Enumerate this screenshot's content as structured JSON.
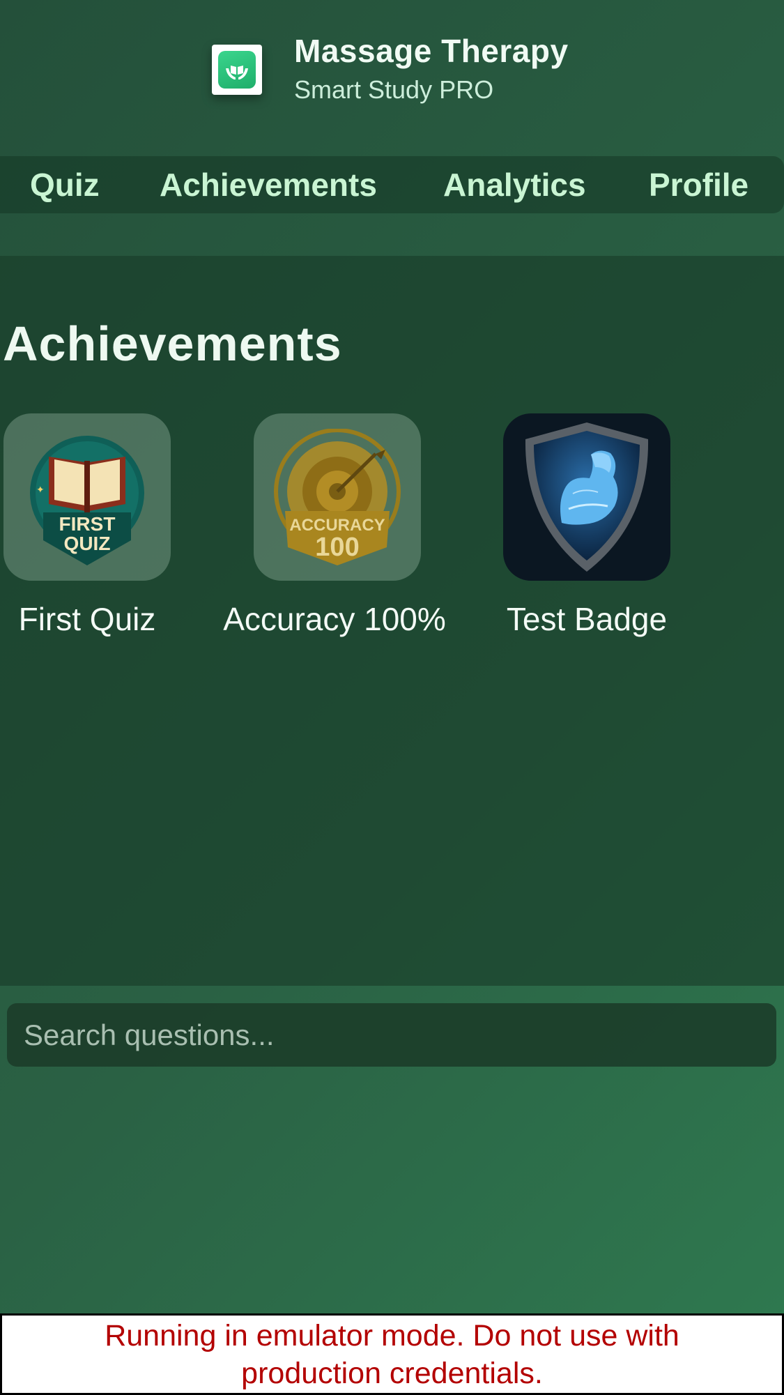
{
  "header": {
    "title": "Massage Therapy",
    "subtitle": "Smart Study PRO",
    "logo_icon": "hands-holding-book-icon"
  },
  "tabs": [
    {
      "label": "Quiz"
    },
    {
      "label": "Achievements"
    },
    {
      "label": "Analytics"
    },
    {
      "label": "Profile"
    }
  ],
  "achievements": {
    "title": "Achievements",
    "badges": [
      {
        "label": "First Quiz",
        "icon": "first-quiz-book-badge-icon",
        "art_lines": [
          "FIRST",
          "QUIZ"
        ],
        "unlocked": false
      },
      {
        "label": "Accuracy 100%",
        "icon": "accuracy-target-badge-icon",
        "art_lines": [
          "ACCURACY",
          "100"
        ],
        "unlocked": false
      },
      {
        "label": "Test Badge",
        "icon": "flexed-arm-shield-badge-icon",
        "unlocked": true
      }
    ]
  },
  "search": {
    "placeholder": "Search questions...",
    "value": ""
  },
  "banner": {
    "text": "Running in emulator mode. Do not use with production credentials."
  },
  "colors": {
    "background": "#2a6144",
    "tab_text": "#c9f5d3",
    "banner_text": "#b30000"
  }
}
